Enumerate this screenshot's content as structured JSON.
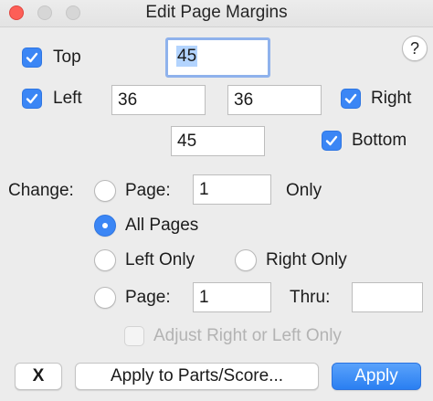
{
  "window": {
    "title": "Edit Page Margins"
  },
  "help": {
    "label": "?"
  },
  "margins": {
    "top": {
      "label": "Top",
      "checked": true,
      "value": "45"
    },
    "left": {
      "label": "Left",
      "checked": true,
      "value": "36"
    },
    "right": {
      "label": "Right",
      "checked": true,
      "value": "36"
    },
    "bottom": {
      "label": "Bottom",
      "checked": true,
      "value": "45"
    }
  },
  "change": {
    "label": "Change:",
    "options": [
      {
        "label": "Page:",
        "selected": false,
        "value": "1",
        "suffix": "Only"
      },
      {
        "label": "All Pages",
        "selected": true
      },
      {
        "label": "Left Only",
        "selected": false
      },
      {
        "label": "Right Only",
        "selected": false
      },
      {
        "label": "Page:",
        "selected": false,
        "value": "1",
        "thru_label": "Thru:",
        "thru_value": ""
      }
    ],
    "adjust": {
      "label": "Adjust Right or Left Only",
      "checked": false,
      "enabled": false
    }
  },
  "buttons": {
    "cancel": "X",
    "apply_parts": "Apply to Parts/Score...",
    "apply": "Apply"
  },
  "colors": {
    "accent": "#3b86f5",
    "close": "#fd5f57"
  }
}
